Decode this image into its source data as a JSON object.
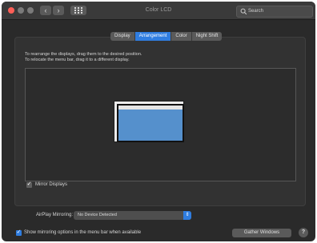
{
  "window": {
    "title": "Color LCD",
    "controls": {
      "close_color": "#ff5f57"
    }
  },
  "toolbar": {
    "back_label": "‹",
    "forward_label": "›",
    "grid_icon": "grid-icon",
    "search_placeholder": "Search"
  },
  "tabs": [
    {
      "label": "Display",
      "active": false
    },
    {
      "label": "Arrangement",
      "active": true
    },
    {
      "label": "Color",
      "active": false
    },
    {
      "label": "Night Shift",
      "active": false
    }
  ],
  "arrangement": {
    "instruction_1": "To rearrange the displays, drag them to the desired position.",
    "instruction_2": "To relocate the menu bar, drag it to a different display.",
    "display_color": "#5590cc"
  },
  "mirror_displays": {
    "label": "Mirror Displays",
    "checked": true
  },
  "airplay": {
    "label": "AirPlay Mirroring:",
    "selected": "No Device Detected"
  },
  "show_mirroring": {
    "label": "Show mirroring options in the menu bar when available",
    "checked": true
  },
  "buttons": {
    "gather_windows": "Gather Windows",
    "help": "?"
  },
  "colors": {
    "accent": "#2f7de0",
    "window_bg": "#2a2a2a"
  }
}
